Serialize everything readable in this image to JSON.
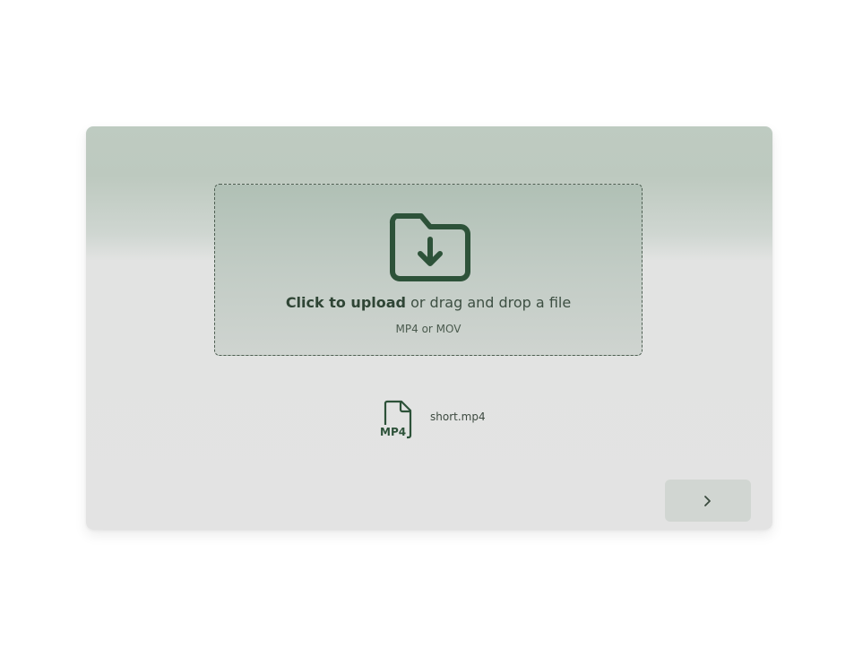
{
  "upload": {
    "cta_bold": "Click to upload",
    "cta_rest": " or drag and drop a file",
    "formats": "MP4 or MOV",
    "icon": "folder-download-icon"
  },
  "file": {
    "name": "short.mp4",
    "badge": "MP4",
    "icon": "mp4-file-icon"
  },
  "actions": {
    "next_icon": "chevron-right-icon"
  },
  "colors": {
    "accent": "#2d5239",
    "card_top": "#becbc1",
    "card_bottom": "#e3e3e3"
  }
}
